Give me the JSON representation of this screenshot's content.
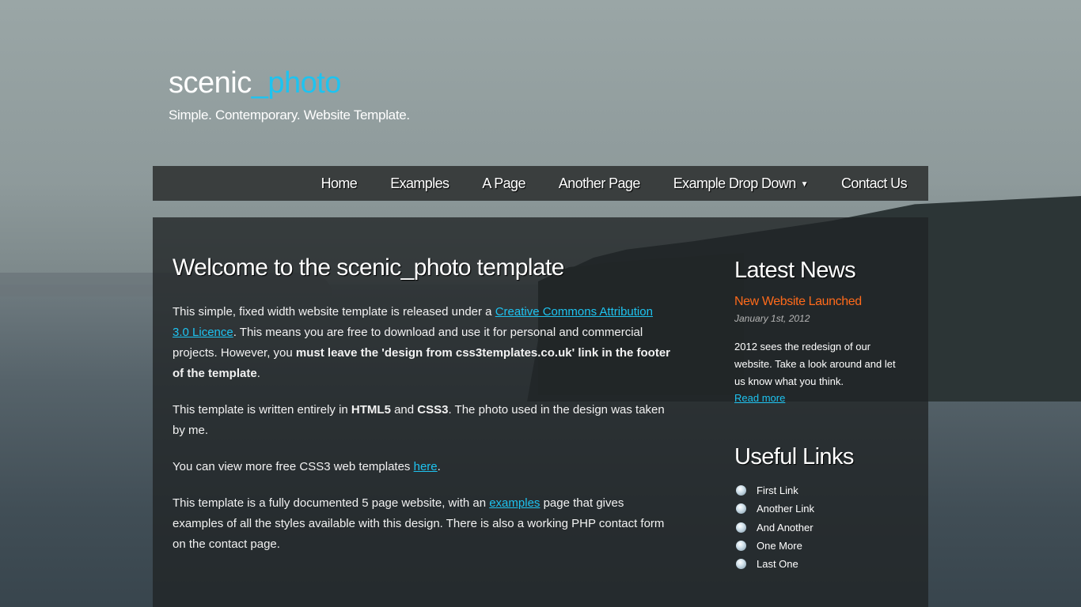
{
  "header": {
    "logo_part1": "scenic",
    "logo_part2": "_photo",
    "slogan": "Simple. Contemporary. Website Template."
  },
  "nav": {
    "items": [
      "Home",
      "Examples",
      "A Page",
      "Another Page",
      "Example Drop Down",
      "Contact Us"
    ]
  },
  "main": {
    "heading": "Welcome to the scenic_photo template",
    "p1": {
      "pre": "This simple, fixed width website template is released under a ",
      "link": "Creative Commons Attribution 3.0 Licence",
      "mid": ". This means you are free to download and use it for personal and commercial projects. However, you ",
      "strong": "must leave the 'design from css3templates.co.uk' link in the footer of the template",
      "post": "."
    },
    "p2": {
      "pre": "This template is written entirely in ",
      "b1": "HTML5",
      "and": " and ",
      "b2": "CSS3",
      "post": ". The photo used in the design was taken by me."
    },
    "p3": {
      "pre": "You can view more free CSS3 web templates ",
      "link": "here",
      "post": "."
    },
    "p4": {
      "pre": "This template is a fully documented 5 page website, with an ",
      "link": "examples",
      "post": " page that gives examples of all the styles available with this design. There is also a working PHP contact form on the contact page."
    }
  },
  "sidebar": {
    "news_heading": "Latest News",
    "news_title": "New Website Launched",
    "news_date": "January 1st, 2012",
    "news_body": "2012 sees the redesign of our website. Take a look around and let us know what you think.",
    "news_more": "Read more",
    "links_heading": "Useful Links",
    "links": [
      "First Link",
      "Another Link",
      "And Another",
      "One More",
      "Last One"
    ]
  },
  "colors": {
    "accent": "#1ec3f0",
    "news_title": "#ff6a1a"
  }
}
